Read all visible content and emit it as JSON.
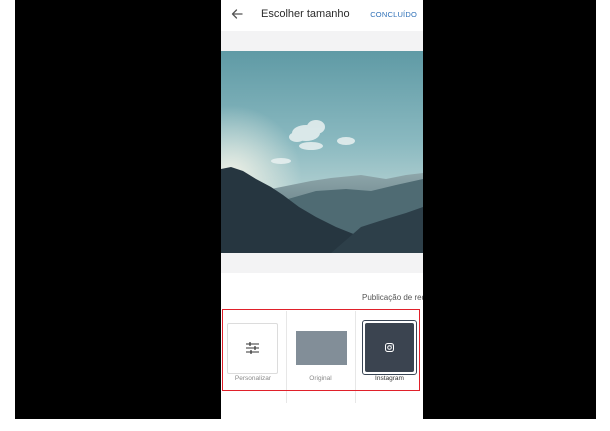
{
  "header": {
    "title": "Escolher tamanho",
    "done_label": "CONCLUÍDO",
    "back_icon": "arrow-left-icon"
  },
  "preview": {
    "image_description_icon": "landscape-photo"
  },
  "size_section": {
    "label": "Publicação de red",
    "options": [
      {
        "label": "Personalizar",
        "icon": "sliders-icon",
        "selected": false
      },
      {
        "label": "Original",
        "icon": "original-rect",
        "selected": false
      },
      {
        "label": "Instagram",
        "icon": "instagram-icon",
        "selected": true
      }
    ]
  },
  "colors": {
    "accent": "#2d6fb7",
    "highlight": "#e0202a",
    "instagram_tile": "#3b4450",
    "original_tile": "#828e98"
  }
}
